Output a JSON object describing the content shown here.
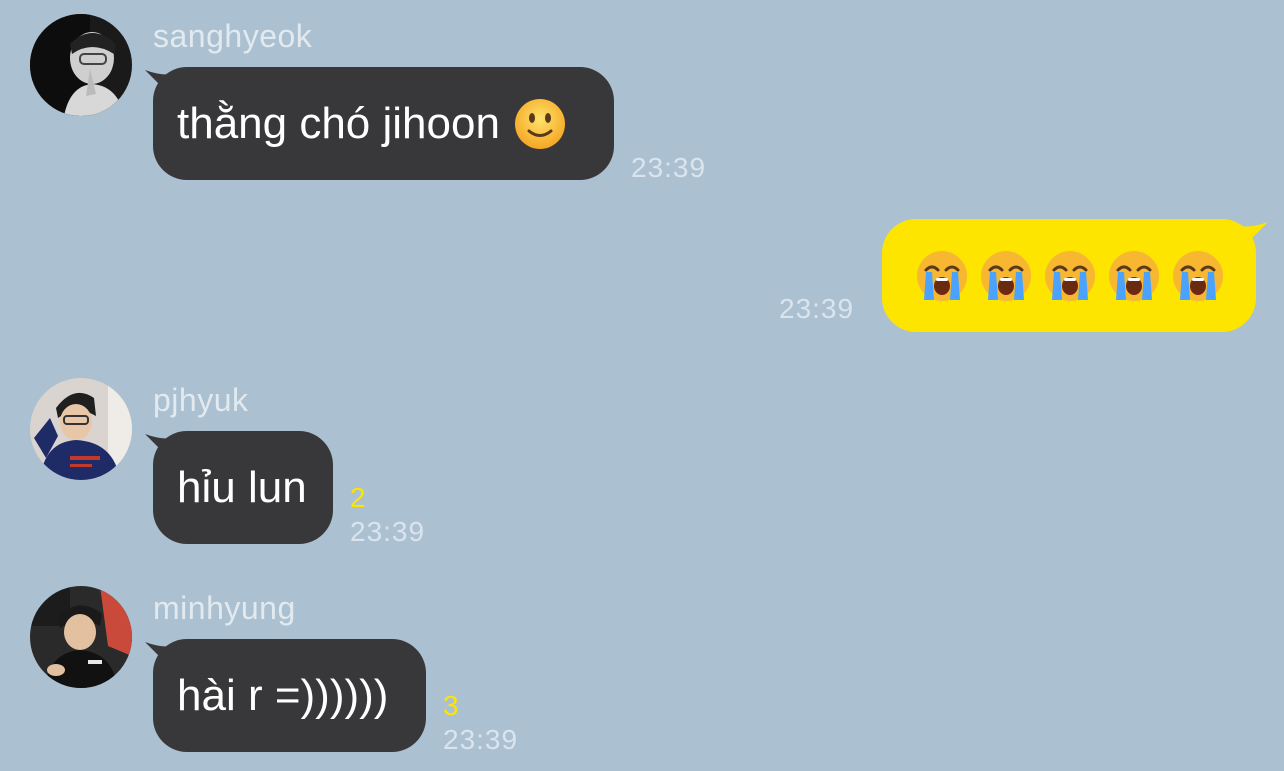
{
  "messages": [
    {
      "sender": "sanghyeok",
      "text": "thằng chó jihoon",
      "emoji": "slightly-smiling-face",
      "time": "23:39"
    },
    {
      "outgoing": true,
      "emojis": [
        "loudly-crying-face",
        "loudly-crying-face",
        "loudly-crying-face",
        "loudly-crying-face",
        "loudly-crying-face"
      ],
      "time": "23:39"
    },
    {
      "sender": "pjhyuk",
      "text": "hỉu lun",
      "unread": "2",
      "time": "23:39"
    },
    {
      "sender": "minhyung",
      "text": "hài r =))))))",
      "unread": "3",
      "time": "23:39"
    }
  ],
  "colors": {
    "background": "#abc1d1",
    "incoming_bubble": "#38383a",
    "outgoing_bubble": "#fee500",
    "unread_count": "#fee500"
  }
}
